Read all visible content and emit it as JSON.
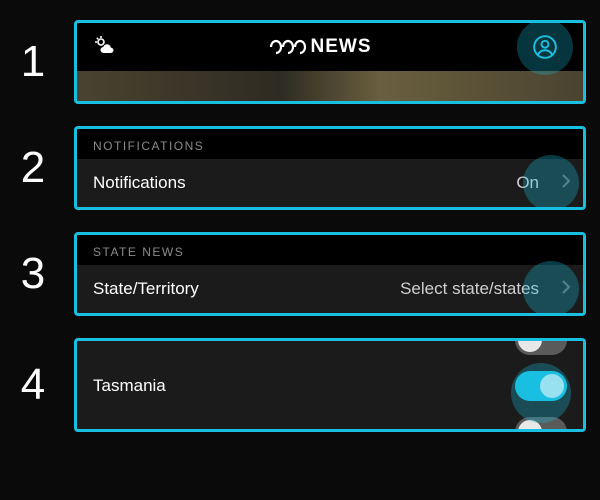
{
  "steps": {
    "s1": "1",
    "s2": "2",
    "s3": "3",
    "s4": "4"
  },
  "header": {
    "brand_text": "NEWS"
  },
  "notifications": {
    "section_label": "NOTIFICATIONS",
    "item_label": "Notifications",
    "item_value": "On"
  },
  "state_news": {
    "section_label": "STATE NEWS",
    "item_label": "State/Territory",
    "item_value": "Select state/states"
  },
  "states": {
    "tasmania": "Tasmania"
  }
}
